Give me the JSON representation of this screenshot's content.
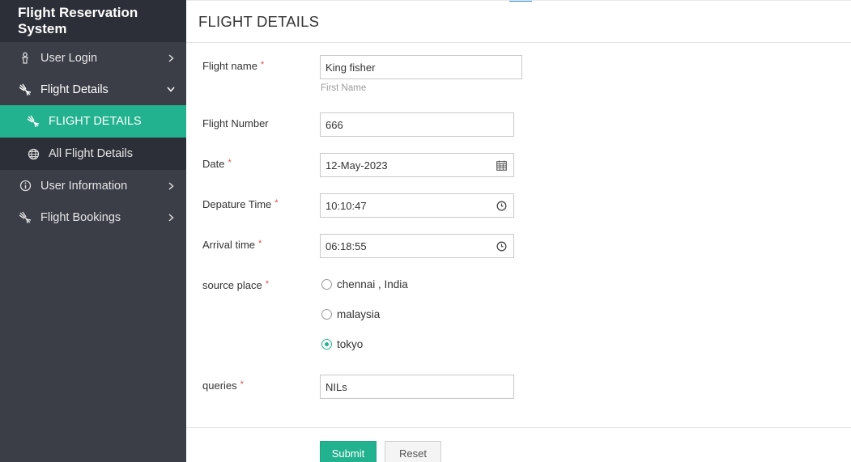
{
  "app": {
    "title": "Flight Reservation System"
  },
  "sidebar": {
    "items": [
      {
        "label": "User Login",
        "icon": "user-icon",
        "chevron": "right"
      },
      {
        "label": "Flight Details",
        "icon": "plane-icon",
        "chevron": "down"
      },
      {
        "label": "User Information",
        "icon": "info-icon",
        "chevron": "right"
      },
      {
        "label": "Flight Bookings",
        "icon": "plane-icon",
        "chevron": "right"
      }
    ],
    "subitems": [
      {
        "label": "FLIGHT DETAILS",
        "icon": "plane-icon",
        "active": true
      },
      {
        "label": "All Flight Details",
        "icon": "globe-icon",
        "active": false
      }
    ]
  },
  "page": {
    "title": "FLIGHT DETAILS"
  },
  "form": {
    "flight_name": {
      "label": "Flight name",
      "required": "*",
      "value": "King fisher",
      "hint": "First Name"
    },
    "flight_number": {
      "label": "Flight Number",
      "value": "666"
    },
    "date": {
      "label": "Date",
      "required": "*",
      "value": "12-May-2023",
      "icon": "calendar-icon"
    },
    "departure_time": {
      "label": "Depature Time",
      "required": "*",
      "value": "10:10:47",
      "icon": "clock-icon"
    },
    "arrival_time": {
      "label": "Arrival time",
      "required": "*",
      "value": "06:18:55",
      "icon": "clock-icon"
    },
    "source_place": {
      "label": "source place",
      "required": "*",
      "options": [
        "chennai , India",
        "malaysia",
        "tokyo"
      ],
      "selected": "tokyo"
    },
    "queries": {
      "label": "queries",
      "required": "*",
      "value": "NILs"
    }
  },
  "buttons": {
    "submit": "Submit",
    "reset": "Reset"
  },
  "colors": {
    "accent": "#23b28f",
    "sidebar_bg": "#3b3d47",
    "sidebar_dark": "#2d2f38",
    "required": "#e05050"
  }
}
